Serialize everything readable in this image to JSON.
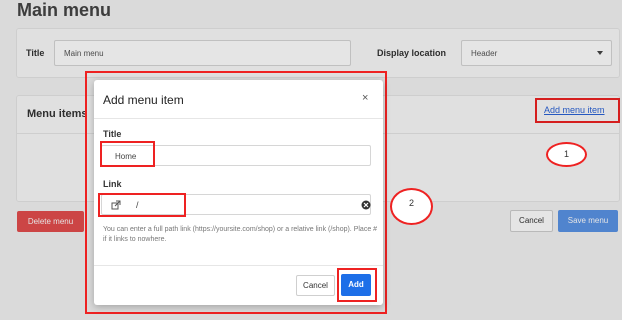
{
  "page": {
    "title": "Main menu"
  },
  "settings": {
    "title_label": "Title",
    "title_value": "Main menu",
    "location_label": "Display location",
    "location_value": "Header"
  },
  "menu_items": {
    "heading": "Menu items",
    "add_link": "Add menu item"
  },
  "footer": {
    "delete_label": "Delete menu",
    "cancel_label": "Cancel",
    "save_label": "Save menu"
  },
  "modal": {
    "title": "Add menu item",
    "close_glyph": "×",
    "title_field_label": "Title",
    "title_field_value": "Home",
    "link_field_label": "Link",
    "link_field_value": "/",
    "help_text": "You can enter a full path link (https://yoursite.com/shop) or a relative link (/shop). Place # if it links to nowhere.",
    "cancel_label": "Cancel",
    "add_label": "Add"
  },
  "annotations": {
    "callout_1": "1",
    "callout_2": "2",
    "color": "#ee2222"
  },
  "colors": {
    "primary": "#1d6fe8",
    "danger": "#e44d4d",
    "link": "#2a62d6"
  },
  "icons": {
    "external_link": "external-link-icon",
    "clear": "clear-circle-icon",
    "dropdown": "chevron-down-icon",
    "close": "close-icon"
  }
}
